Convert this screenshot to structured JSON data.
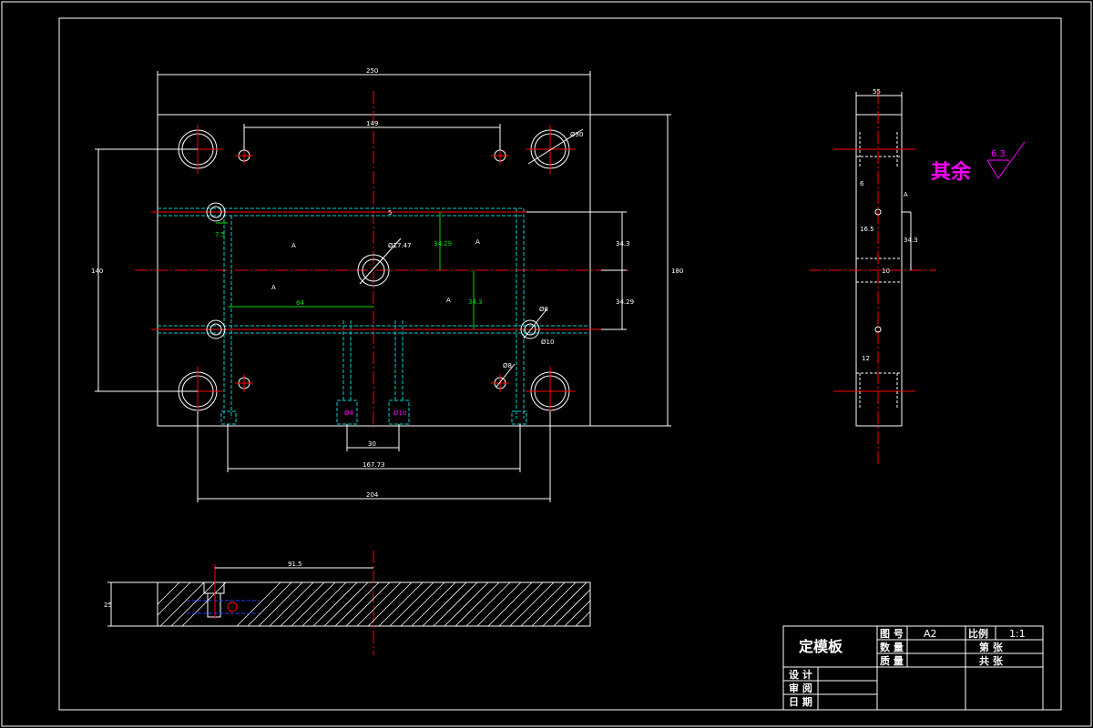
{
  "drawing": {
    "title_block": {
      "part_name": "定模板",
      "drawing_no_label": "图 号",
      "drawing_no_value": "A2",
      "scale_label": "比例",
      "scale_value": "1:1",
      "quantity_label": "数 量",
      "sheet_label": "第  张",
      "weight_label": "质 量",
      "total_label": "共  张",
      "design_label": "设 计",
      "review_label": "审 阅",
      "date_label": "日 期"
    },
    "remark": {
      "text": "其余",
      "roughness": "6.3"
    },
    "dims": {
      "overall_width": "250",
      "top_span": "149",
      "hole_dia": "Ø30",
      "left_height": "140",
      "right_height": "180",
      "slot": "5",
      "dim_75": "7.5",
      "sprue": "Ø17.47",
      "v1": "34.29",
      "v2": "34.3",
      "v3": "34.3",
      "v4": "34.29",
      "d64": "64",
      "d8": "Ø8",
      "d10": "Ø10",
      "d8b": "Ø8",
      "d30": "30",
      "d16773": "167.73",
      "d204": "204",
      "pin1": "Ø4",
      "pin2": "Ø10",
      "side_w": "55",
      "side_6": "6",
      "side_165": "16.5",
      "side_343": "34.3",
      "side_12": "12",
      "side_10": "10",
      "sec_len": "91.5",
      "sec_h": "25",
      "rough": "A"
    }
  }
}
